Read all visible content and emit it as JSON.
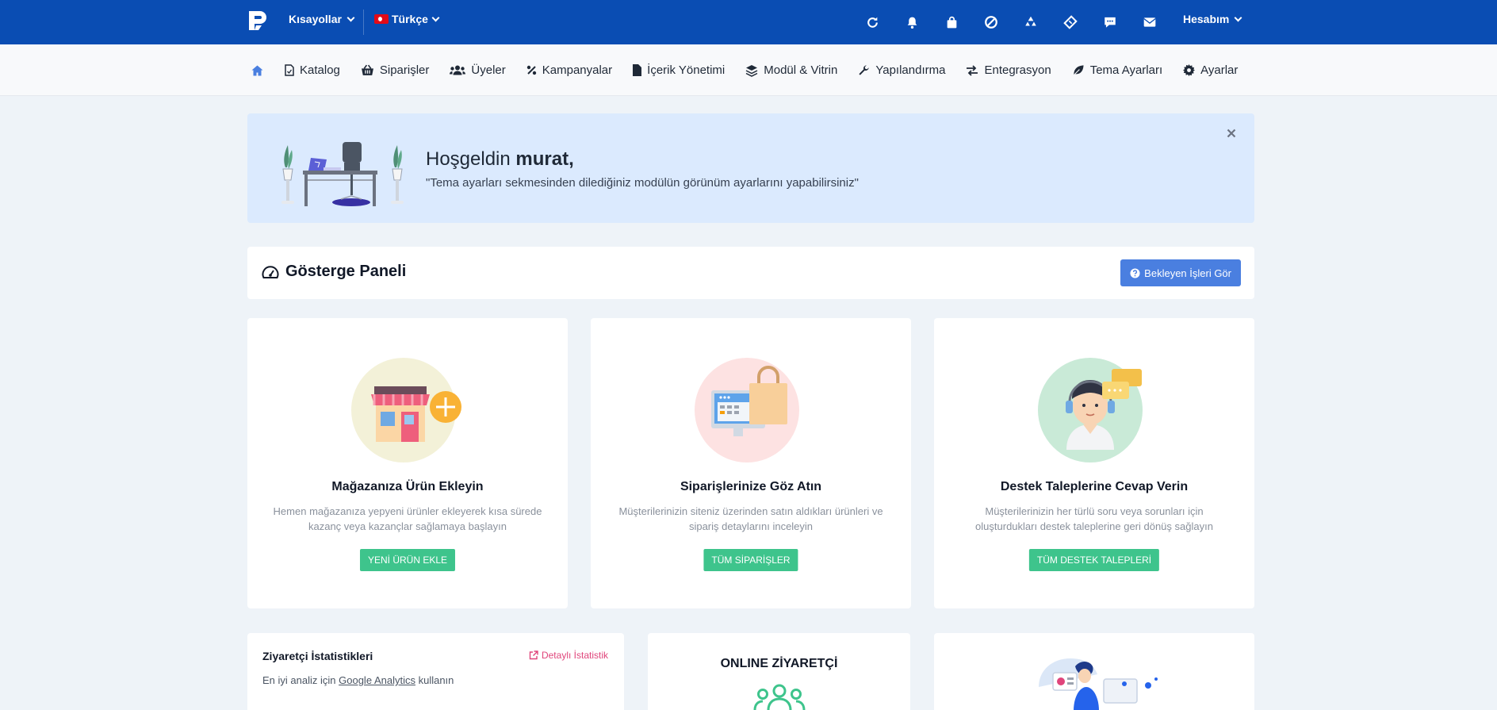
{
  "topbar": {
    "shortcuts_label": "Kısayollar",
    "language_label": "Türkçe",
    "account_label": "Hesabım",
    "icons": [
      "refresh-icon",
      "bell-icon",
      "shopping-bag-icon",
      "ban-icon",
      "recycle-icon",
      "ticket-icon",
      "comment-icon",
      "envelope-icon"
    ],
    "bg_color": "#0a4db3"
  },
  "nav": {
    "items": [
      {
        "label": "Katalog"
      },
      {
        "label": "Siparişler"
      },
      {
        "label": "Üyeler"
      },
      {
        "label": "Kampanyalar"
      },
      {
        "label": "İçerik Yönetimi"
      },
      {
        "label": "Modül & Vitrin"
      },
      {
        "label": "Yapılandırma"
      },
      {
        "label": "Entegrasyon"
      },
      {
        "label": "Tema Ayarları"
      },
      {
        "label": "Ayarlar"
      }
    ]
  },
  "welcome": {
    "greeting": "Hoşgeldin",
    "username": "murat,",
    "message": "\"Tema ayarları sekmesinden dilediğiniz modülün görünüm ayarlarını yapabilirsiniz\""
  },
  "dashboard": {
    "title": "Gösterge Paneli",
    "pending_button": "Bekleyen İşleri Gör"
  },
  "cards": [
    {
      "title": "Mağazanıza Ürün Ekleyin",
      "description": "Hemen mağazanıza yepyeni ürünler ekleyerek kısa sürede kazanç veya kazançlar sağlamaya başlayın",
      "button": "YENİ ÜRÜN EKLE"
    },
    {
      "title": "Siparişlerinize Göz Atın",
      "description": "Müşterilerinizin siteniz üzerinden satın aldıkları ürünleri ve sipariş detaylarını inceleyin",
      "button": "TÜM SİPARİŞLER"
    },
    {
      "title": "Destek Taleplerine Cevap Verin",
      "description": "Müşterilerinizin her türlü soru veya sorunları için oluşturdukları destek taleplerine geri dönüş sağlayın",
      "button": "TÜM DESTEK TALEPLERİ"
    }
  ],
  "visitor_stats": {
    "title": "Ziyaretçi İstatistikleri",
    "detail_link": "Detaylı İstatistik",
    "subtitle_prefix": "En iyi analiz için",
    "subtitle_link": "Google Analytics",
    "subtitle_suffix": "kullanın"
  },
  "online": {
    "title": "ONLINE ZİYARETÇİ"
  },
  "colors": {
    "accent_button": "#4a7fe0",
    "success_button": "#3ec48c",
    "welcome_bg": "#dbeafe",
    "link_pink": "#e0457b"
  }
}
